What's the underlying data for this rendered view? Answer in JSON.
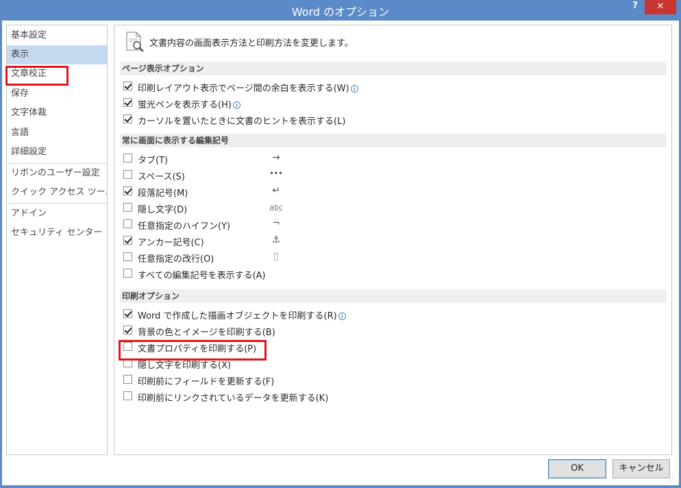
{
  "window": {
    "title": "Word のオプション",
    "help_label": "?",
    "close_label": "✕"
  },
  "nav": {
    "items": [
      {
        "label": "基本設定"
      },
      {
        "label": "表示"
      },
      {
        "label": "文章校正"
      },
      {
        "label": "保存"
      },
      {
        "label": "文字体裁"
      },
      {
        "label": "言語"
      },
      {
        "label": "詳細設定"
      },
      {
        "label": "リボンのユーザー設定"
      },
      {
        "label": "クイック アクセス ツール バー"
      },
      {
        "label": "アドイン"
      },
      {
        "label": "セキュリティ センター"
      }
    ],
    "selected": "表示"
  },
  "header": {
    "icon": "document-magnifier-icon",
    "text": "文書内容の画面表示方法と印刷方法を変更します。"
  },
  "sections": {
    "page_display": {
      "title": "ページ表示オプション",
      "options": [
        {
          "label": "印刷レイアウト表示でページ間の余白を表示する(W)",
          "checked": true,
          "info": true
        },
        {
          "label": "蛍光ペンを表示する(H)",
          "checked": true,
          "info": true
        },
        {
          "label": "カーソルを置いたときに文書のヒントを表示する(L)",
          "checked": true,
          "info": false
        }
      ]
    },
    "format_marks": {
      "title": "常に画面に表示する編集記号",
      "options": [
        {
          "label": "タブ(T)",
          "checked": false,
          "symbol": "→"
        },
        {
          "label": "スペース(S)",
          "checked": false,
          "symbol": "•••"
        },
        {
          "label": "段落記号(M)",
          "checked": true,
          "symbol": "↵"
        },
        {
          "label": "隠し文字(D)",
          "checked": false,
          "symbol": "abc"
        },
        {
          "label": "任意指定のハイフン(Y)",
          "checked": false,
          "symbol": "¬"
        },
        {
          "label": "アンカー記号(C)",
          "checked": true,
          "symbol": "⚓"
        },
        {
          "label": "任意指定の改行(O)",
          "checked": false,
          "symbol": "▯"
        },
        {
          "label": "すべての編集記号を表示する(A)",
          "checked": false
        }
      ]
    },
    "print": {
      "title": "印刷オプション",
      "options": [
        {
          "label": "Word で作成した描画オブジェクトを印刷する(R)",
          "checked": true,
          "info": true
        },
        {
          "label": "背景の色とイメージを印刷する(B)",
          "checked": true,
          "info": false
        },
        {
          "label": "文書プロパティを印刷する(P)",
          "checked": false,
          "info": false
        },
        {
          "label": "隠し文字を印刷する(X)",
          "checked": false,
          "info": false
        },
        {
          "label": "印刷前にフィールドを更新する(F)",
          "checked": false,
          "info": false
        },
        {
          "label": "印刷前にリンクされているデータを更新する(K)",
          "checked": false,
          "info": false
        }
      ]
    }
  },
  "buttons": {
    "ok": "OK",
    "cancel": "キャンセル"
  },
  "colors": {
    "title_bar": "#5b8ac8",
    "close": "#c7372f",
    "selected_nav": "#c5d9f1",
    "highlight_box": "#e0141a"
  }
}
